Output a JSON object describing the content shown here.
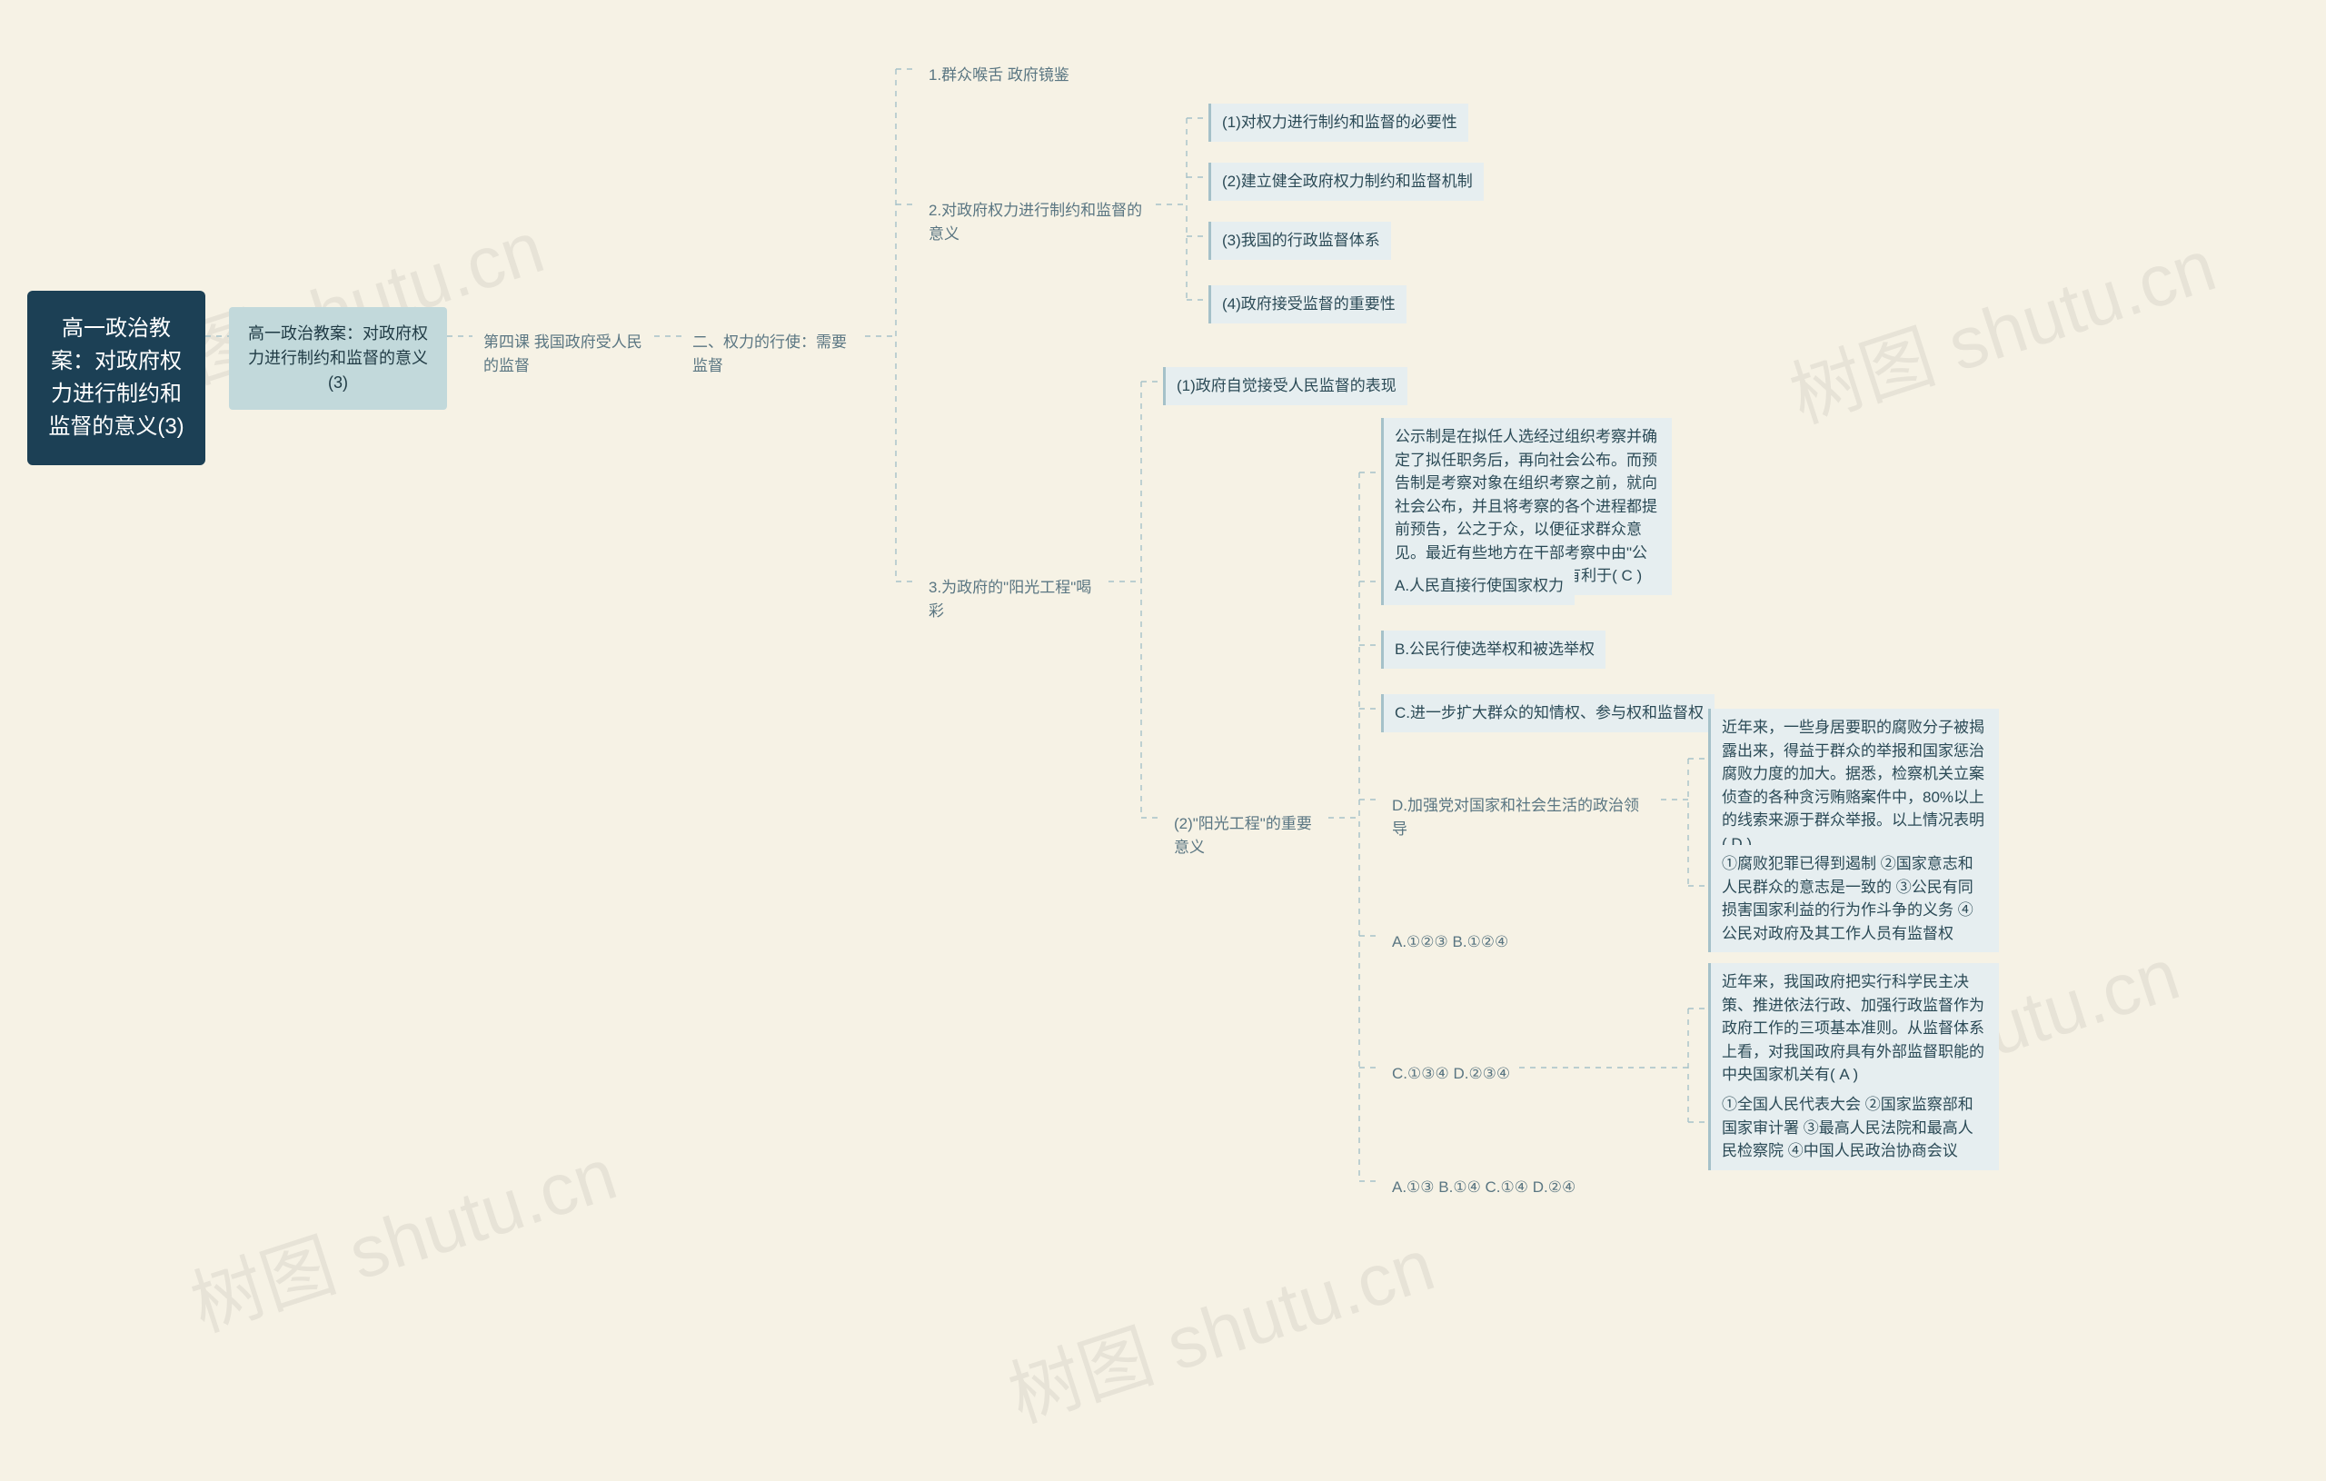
{
  "watermarks": [
    "树图 shutu.cn",
    "树图 shutu.cn",
    "树图 shutu.cn",
    "树图 shutu.cn",
    "树图 shutu.cn"
  ],
  "root": "高一政治教案：对政府权力进行制约和监督的意义(3)",
  "sub1": "高一政治教案：对政府权力进行制约和监督的意义(3)",
  "lesson": "第四课 我国政府受人民的监督",
  "section2": "二、权力的行使：需要监督",
  "b1": "1.群众喉舌 政府镜鉴",
  "b2": "2.对政府权力进行制约和监督的意义",
  "b2_1": "(1)对权力进行制约和监督的必要性",
  "b2_2": "(2)建立健全政府权力制约和监督机制",
  "b2_3": "(3)我国的行政监督体系",
  "b2_4": "(4)政府接受监督的重要性",
  "b3": "3.为政府的\"阳光工程\"喝彩",
  "b3_1": "(1)政府自觉接受人民监督的表现",
  "b3_2": "(2)\"阳光工程\"的重要意义",
  "b3_2_q": "公示制是在拟任人选经过组织考察并确定了拟任职务后，再向社会公布。而预告制是考察对象在组织考察之前，就向社会公布，并且将考察的各个进程都提前预告，公之于众，以便征求群众意见。最近有些地方在干部考察中由\"公示制\"改为\"预告制\"。这将有利于( C )",
  "b3_2_a": "A.人民直接行使国家权力",
  "b3_2_b": "B.公民行使选举权和被选举权",
  "b3_2_c": "C.进一步扩大群众的知情权、参与权和监督权",
  "b3_2_d": "D.加强党对国家和社会生活的政治领导",
  "b3_2_d_q": "近年来，一些身居要职的腐败分子被揭露出来，得益于群众的举报和国家惩治腐败力度的加大。据悉，检察机关立案侦查的各种贪污贿赂案件中，80%以上的线索来源于群众举报。以上情况表明( D )",
  "b3_2_d_opts": "①腐败犯罪已得到遏制 ②国家意志和人民群众的意志是一致的 ③公民有同损害国家利益的行为作斗争的义务 ④公民对政府及其工作人员有监督权",
  "ans_ab": "A.①②③ B.①②④",
  "ans_cd": "C.①③④ D.②③④",
  "ans_cd_q": "近年来，我国政府把实行科学民主决策、推进依法行政、加强行政监督作为政府工作的三项基本准则。从监督体系上看，对我国政府具有外部监督职能的中央国家机关有( A )",
  "ans_cd_opts": "①全国人民代表大会 ②国家监察部和国家审计署 ③最高人民法院和最高人民检察院 ④中国人民政治协商会议",
  "ans_final": "A.①③ B.①④ C.①④ D.②④"
}
